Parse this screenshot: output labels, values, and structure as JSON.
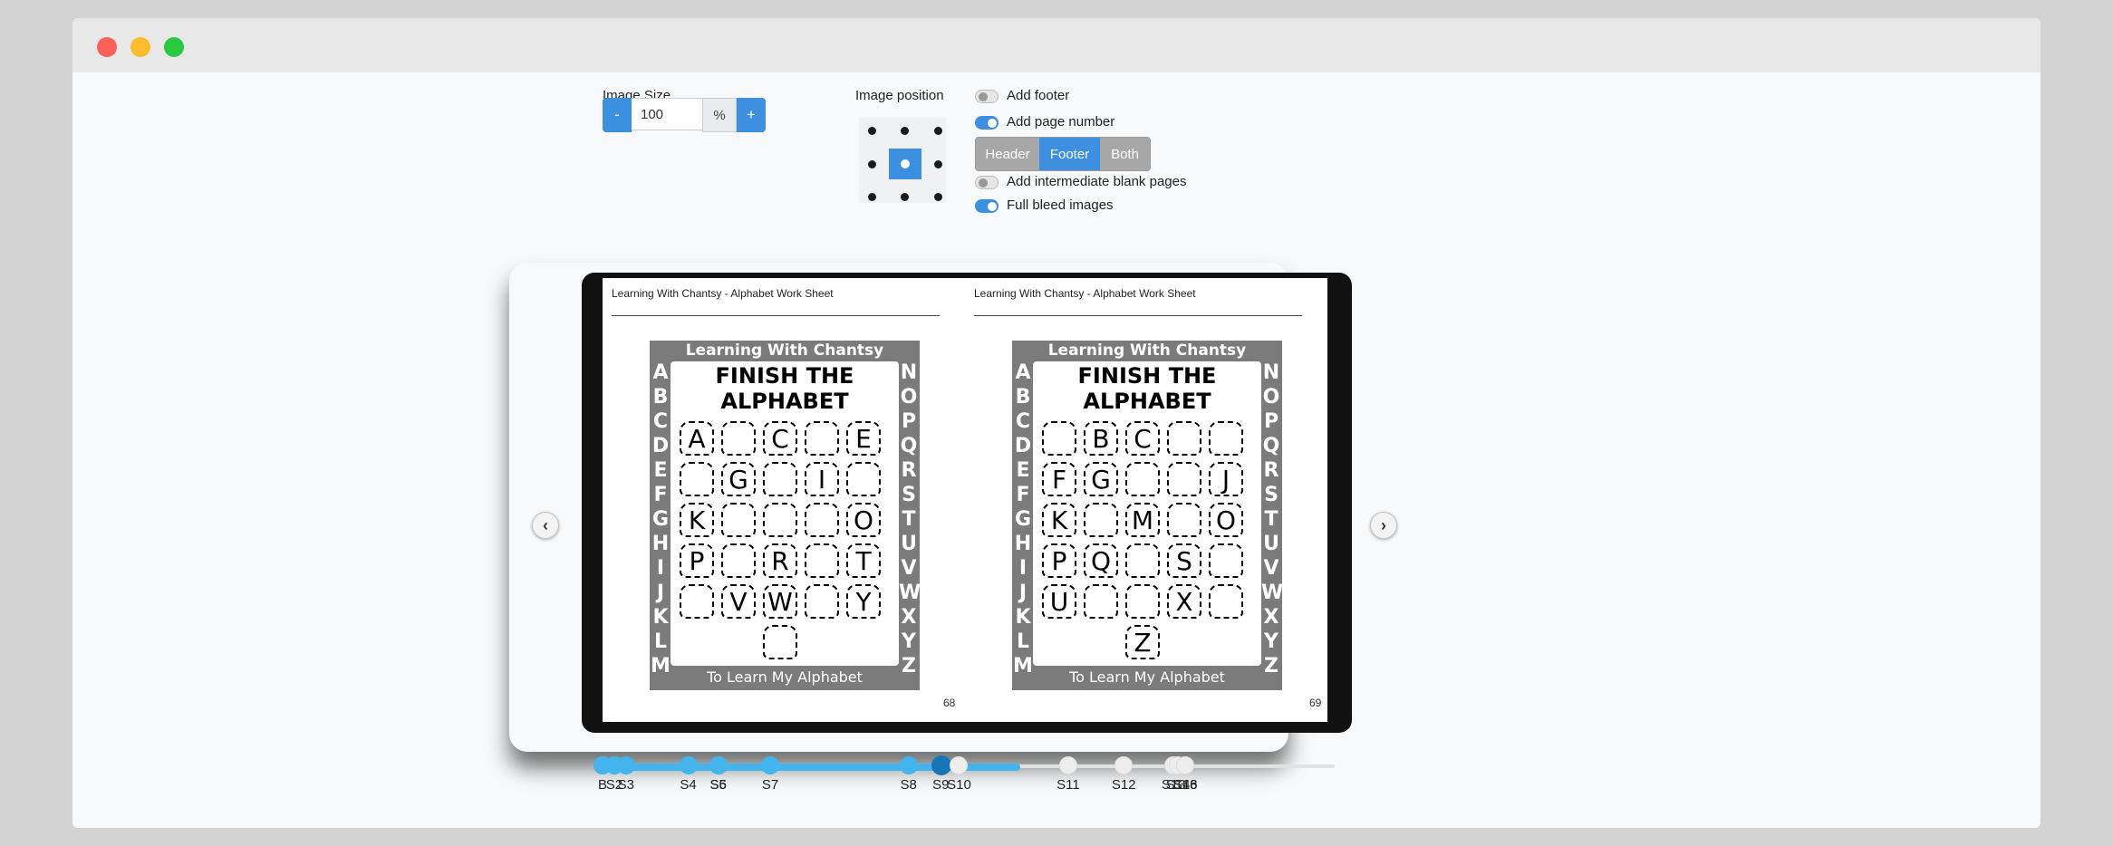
{
  "controls": {
    "image_size": {
      "label": "Image Size",
      "minus": "-",
      "value": "100",
      "unit": "%",
      "plus": "+"
    },
    "image_position": {
      "label": "Image position",
      "selected": "center"
    },
    "options": [
      {
        "label": "Add footer",
        "on": false
      },
      {
        "label": "Add page number",
        "on": true
      },
      {
        "label": "Add intermediate blank pages",
        "on": false
      },
      {
        "label": "Full bleed images",
        "on": true
      }
    ],
    "page_number_position": {
      "options": [
        "Header",
        "Footer",
        "Both"
      ],
      "selected": "Footer"
    }
  },
  "spread": {
    "left": {
      "header": "Learning With Chantsy - Alphabet Work Sheet",
      "page_number": "68",
      "worksheet": {
        "top": "Learning With Chantsy",
        "title": "FINISH THE ALPHABET",
        "bottom": "To Learn My Alphabet",
        "left_column": [
          "A",
          "B",
          "C",
          "D",
          "E",
          "F",
          "G",
          "H",
          "I",
          "J",
          "K",
          "L",
          "M"
        ],
        "right_column": [
          "N",
          "O",
          "P",
          "Q",
          "R",
          "S",
          "T",
          "U",
          "V",
          "W",
          "X",
          "Y",
          "Z"
        ],
        "grid": [
          [
            "A",
            "",
            "C",
            "",
            "E"
          ],
          [
            "",
            "G",
            "",
            "I",
            ""
          ],
          [
            "K",
            "",
            "",
            "",
            "O"
          ],
          [
            "P",
            "",
            "R",
            "",
            "T"
          ],
          [
            "",
            "V",
            "W",
            "",
            "Y"
          ],
          [
            ""
          ]
        ]
      }
    },
    "right": {
      "header": "Learning With Chantsy - Alphabet Work Sheet",
      "page_number": "69",
      "worksheet": {
        "top": "Learning With Chantsy",
        "title": "FINISH THE ALPHABET",
        "bottom": "To Learn My Alphabet",
        "left_column": [
          "A",
          "B",
          "C",
          "D",
          "E",
          "F",
          "G",
          "H",
          "I",
          "J",
          "K",
          "L",
          "M"
        ],
        "right_column": [
          "N",
          "O",
          "P",
          "Q",
          "R",
          "S",
          "T",
          "U",
          "V",
          "W",
          "X",
          "Y",
          "Z"
        ],
        "grid": [
          [
            "",
            "B",
            "C",
            "",
            ""
          ],
          [
            "F",
            "G",
            "",
            "",
            "J"
          ],
          [
            "K",
            "",
            "M",
            "",
            "O"
          ],
          [
            "P",
            "Q",
            "",
            "S",
            ""
          ],
          [
            "U",
            "",
            "",
            "X",
            ""
          ],
          [
            "Z"
          ]
        ]
      }
    }
  },
  "navigation": {
    "prev_icon": "chevron-left-icon",
    "next_icon": "chevron-right-icon"
  },
  "timeline": {
    "current": "S9",
    "progress_fraction": 0.57,
    "ticks": [
      {
        "label": "B",
        "state": "done"
      },
      {
        "label": "S2",
        "state": "done"
      },
      {
        "label": "S3",
        "state": "done"
      },
      {
        "label": "S4",
        "state": "done"
      },
      {
        "label": "S5",
        "state": "done"
      },
      {
        "label": "S6",
        "state": "done"
      },
      {
        "label": "S7",
        "state": "done"
      },
      {
        "label": "S8",
        "state": "done"
      },
      {
        "label": "S9",
        "state": "current"
      },
      {
        "label": "S10",
        "state": "future"
      },
      {
        "label": "S11",
        "state": "future"
      },
      {
        "label": "S12",
        "state": "future"
      },
      {
        "label": "S13",
        "state": "future"
      },
      {
        "label": "S14",
        "state": "future"
      },
      {
        "label": "S16",
        "state": "future"
      },
      {
        "label": "S18",
        "state": "future"
      }
    ]
  },
  "colors": {
    "accent": "#3d8fe0",
    "track": "#44b4ee",
    "current_tick": "#1775b8",
    "worksheet_frame": "#7b7b7b"
  }
}
